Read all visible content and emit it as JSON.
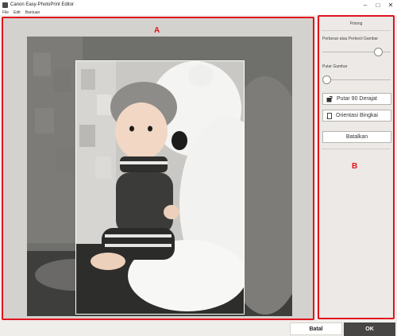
{
  "window": {
    "title": "Canon Easy-PhotoPrint Editor",
    "minimize_glyph": "–",
    "maximize_glyph": "□",
    "close_glyph": "✕"
  },
  "menu": [
    "File",
    "Edit",
    "Bantuan"
  ],
  "labels": {
    "a": "A",
    "b": "B"
  },
  "panel": {
    "title": "Potong",
    "zoom_label": "Perbesar atau Perkecil Gambar",
    "zoom_level": 0.82,
    "rotate_label": "Putar Gambar",
    "rotate_level": 0.0,
    "rotate90_label": "Putar 90 Derajat",
    "frame_orientation_label": "Orientasi Bingkai",
    "undo_label": "Batalkan"
  },
  "footer": {
    "cancel_label": "Batal",
    "ok_label": "OK"
  },
  "colors": {
    "accent_red": "#e0141e",
    "ok_bg": "#484644"
  }
}
